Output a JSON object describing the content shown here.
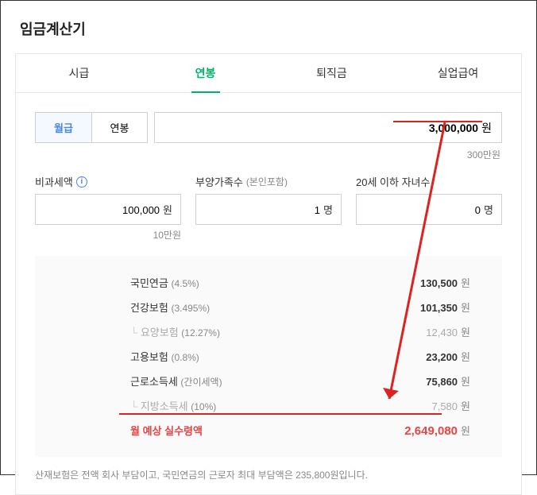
{
  "title": "임금계산기",
  "tabs": {
    "items": [
      "시급",
      "연봉",
      "퇴직금",
      "실업급여"
    ],
    "active": "연봉"
  },
  "mode": {
    "options": [
      "월급",
      "연봉"
    ],
    "active": "월급"
  },
  "salary": {
    "value": "3,000,000",
    "unit": "원",
    "hint": "300만원"
  },
  "fields": {
    "taxfree": {
      "label": "비과세액",
      "value": "100,000",
      "unit": "원",
      "hint": "10만원"
    },
    "family": {
      "label": "부양가족수",
      "sub": "(본인포함)",
      "value": "1",
      "unit": "명"
    },
    "child": {
      "label": "20세 이하 자녀수",
      "value": "0",
      "unit": "명"
    }
  },
  "results": {
    "rows": [
      {
        "label": "국민연금",
        "pct": "(4.5%)",
        "value": "130,500",
        "sub": false
      },
      {
        "label": "건강보험",
        "pct": "(3.495%)",
        "value": "101,350",
        "sub": false
      },
      {
        "label": "요양보험",
        "pct": "(12.27%)",
        "value": "12,430",
        "sub": true
      },
      {
        "label": "고용보험",
        "pct": "(0.8%)",
        "value": "23,200",
        "sub": false
      },
      {
        "label": "근로소득세",
        "pct": "(간이세액)",
        "value": "75,860",
        "sub": false
      },
      {
        "label": "지방소득세",
        "pct": "(10%)",
        "value": "7,580",
        "sub": true
      }
    ],
    "unit": "원",
    "total": {
      "label": "월 예상 실수령액",
      "value": "2,649,080"
    }
  },
  "footnote": "산재보험은 전액 회사 부담이고, 국민연금의 근로자 최대 부담액은 235,800원입니다."
}
